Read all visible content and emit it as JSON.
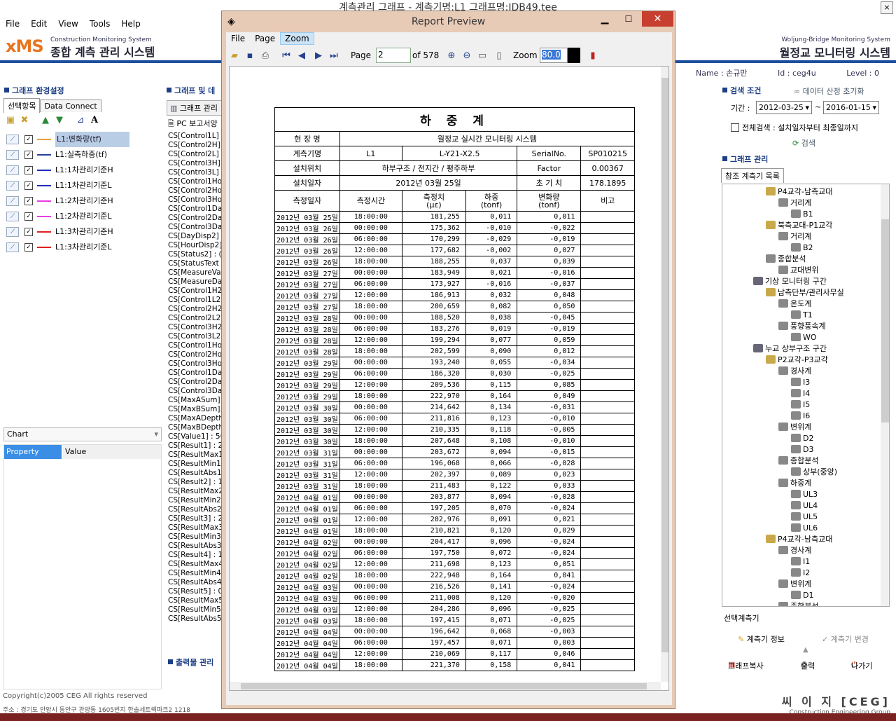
{
  "main_window": {
    "title": "계측관리 그래프 - 계측기명:L1 그래프명:IDB49.tee",
    "close_glyph": "×",
    "menu": [
      "File",
      "Edit",
      "View",
      "Tools",
      "Help"
    ]
  },
  "brand_left": {
    "logo": "xMS",
    "sub": "Construction   Monitoring System",
    "ko": "종합 계측 관리 시스템"
  },
  "brand_right": {
    "sub": "Woljung-Bridge  Monitoring System",
    "ko": "월정교 모니터링 시스템"
  },
  "left_panel": {
    "header": "그래프 환경설정",
    "tabs": [
      "선택항목",
      "Data Connect"
    ],
    "series": [
      {
        "label": "L1:변화량(tf)",
        "color": "#e8a040",
        "checked": true
      },
      {
        "label": "L1:실측하중(tf)",
        "color": "#2a3f9a",
        "checked": true
      },
      {
        "label": "L1:1차관리기준H",
        "color": "#1c2fb8",
        "checked": true
      },
      {
        "label": "L1:1차관리기준L",
        "color": "#1c2fb8",
        "checked": true
      },
      {
        "label": "L1:2차관리기준H",
        "color": "#e83ce8",
        "checked": true
      },
      {
        "label": "L1:2차관리기준L",
        "color": "#e83ce8",
        "checked": true
      },
      {
        "label": "L1:3차관리기준H",
        "color": "#e02020",
        "checked": true
      },
      {
        "label": "L1:3차관리기준L",
        "color": "#e02020",
        "checked": true
      }
    ],
    "chart_combo": "Chart",
    "property_header": "Property",
    "value_header": "Value"
  },
  "mid_panel": {
    "header": "그래프 및 데",
    "tab": "그래프 관리",
    "sub": "PC 보고서양",
    "out_header": "출력물 관리",
    "items": [
      "CS[Control1L]",
      "CS[Control2H]",
      "CS[Control2L]",
      "CS[Control3H]",
      "CS[Control3L]",
      "CS[Control1Ho",
      "CS[Control2Ho",
      "CS[Control3Ho",
      "CS[Control1Da",
      "CS[Control2Da",
      "CS[Control3Da",
      "CS[DayDisp2] :",
      "CS[HourDisp2]",
      "CS[Status2] : (",
      "CS[StatusText",
      "CS[MeasureVal",
      "CS[MeasureDa",
      "CS[Control1H2",
      "CS[Control1L2]",
      "CS[Control2H2",
      "CS[Control2L2]",
      "CS[Control3H2",
      "CS[Control3L2]",
      "CS[Control1Ho",
      "CS[Control2Ho",
      "CS[Control3Ho",
      "CS[Control1Da",
      "CS[Control2Da",
      "CS[Control3Da",
      "CS[MaxASum]",
      "CS[MaxBSum]",
      "CS[MaxADepth",
      "CS[MaxBDepth",
      "CS[Value1] : 56",
      "CS[Result1] : 2",
      "CS[ResultMax1",
      "CS[ResultMin1]",
      "CS[ResultAbs1",
      "CS[Result2] : 1",
      "CS[ResultMax2",
      "CS[ResultMin2]",
      "CS[ResultAbs2",
      "CS[Result3] : 2",
      "CS[ResultMax3",
      "CS[ResultMin3]",
      "CS[ResultAbs3",
      "CS[Result4] : 1",
      "CS[ResultMax4",
      "CS[ResultMin4]",
      "CS[ResultAbs4",
      "CS[Result5] : 0",
      "CS[ResultMax5",
      "CS[ResultMin5]",
      "CS[ResultAbs5"
    ]
  },
  "report_preview": {
    "title": "Report Preview",
    "menu": [
      "File",
      "Page",
      "Zoom"
    ],
    "page_label": "Page",
    "page_value": "2",
    "page_of": "of 578",
    "zoom_label": "Zoom",
    "zoom_value": "80.0",
    "report": {
      "title": "하 중 계",
      "site_label": "현 장 명",
      "site_value": "월정교 실시간 모니터링 시스템",
      "instrument_label": "계측기명",
      "instrument_value": "L1",
      "model_value": "L-Y21-X2.5",
      "serial_label": "SerialNo.",
      "serial_value": "SP010215",
      "location_label": "설치위치",
      "location_value": "하부구조  /  전지간  / 평주하부",
      "factor_label": "Factor",
      "factor_value": "0.00367",
      "install_label": "설치일자",
      "install_value": "2012년 03월 25일",
      "initial_label": "초 기 치",
      "initial_value": "178.1895",
      "columns": [
        {
          "line1": "측정일자",
          "line2": ""
        },
        {
          "line1": "측정시간",
          "line2": ""
        },
        {
          "line1": "측정치",
          "line2": "(με)"
        },
        {
          "line1": "하중",
          "line2": "(tonf)"
        },
        {
          "line1": "변화량",
          "line2": "(tonf)"
        },
        {
          "line1": "비고",
          "line2": ""
        }
      ],
      "rows": [
        [
          "2012년 03월 25일",
          "18:00:00",
          "181,255",
          "0,011",
          "0,011",
          ""
        ],
        [
          "2012년 03월 26일",
          "00:00:00",
          "175,362",
          "-0,010",
          "-0,022",
          ""
        ],
        [
          "2012년 03월 26일",
          "06:00:00",
          "170,299",
          "-0,029",
          "-0,019",
          ""
        ],
        [
          "2012년 03월 26일",
          "12:00:00",
          "177,682",
          "-0,002",
          "0,027",
          ""
        ],
        [
          "2012년 03월 26일",
          "18:00:00",
          "188,255",
          "0,037",
          "0,039",
          ""
        ],
        [
          "2012년 03월 27일",
          "00:00:00",
          "183,949",
          "0,021",
          "-0,016",
          ""
        ],
        [
          "2012년 03월 27일",
          "06:00:00",
          "173,927",
          "-0,016",
          "-0,037",
          ""
        ],
        [
          "2012년 03월 27일",
          "12:00:00",
          "186,913",
          "0,032",
          "0,048",
          ""
        ],
        [
          "2012년 03월 27일",
          "18:00:00",
          "200,659",
          "0,082",
          "0,050",
          ""
        ],
        [
          "2012년 03월 28일",
          "00:00:00",
          "188,520",
          "0,038",
          "-0,045",
          ""
        ],
        [
          "2012년 03월 28일",
          "06:00:00",
          "183,276",
          "0,019",
          "-0,019",
          ""
        ],
        [
          "2012년 03월 28일",
          "12:00:00",
          "199,294",
          "0,077",
          "0,059",
          ""
        ],
        [
          "2012년 03월 28일",
          "18:00:00",
          "202,599",
          "0,090",
          "0,012",
          ""
        ],
        [
          "2012년 03월 29일",
          "00:00:00",
          "193,240",
          "0,055",
          "-0,034",
          ""
        ],
        [
          "2012년 03월 29일",
          "06:00:00",
          "186,320",
          "0,030",
          "-0,025",
          ""
        ],
        [
          "2012년 03월 29일",
          "12:00:00",
          "209,536",
          "0,115",
          "0,085",
          ""
        ],
        [
          "2012년 03월 29일",
          "18:00:00",
          "222,970",
          "0,164",
          "0,049",
          ""
        ],
        [
          "2012년 03월 30일",
          "00:00:00",
          "214,642",
          "0,134",
          "-0,031",
          ""
        ],
        [
          "2012년 03월 30일",
          "06:00:00",
          "211,816",
          "0,123",
          "-0,010",
          ""
        ],
        [
          "2012년 03월 30일",
          "12:00:00",
          "210,335",
          "0,118",
          "-0,005",
          ""
        ],
        [
          "2012년 03월 30일",
          "18:00:00",
          "207,648",
          "0,108",
          "-0,010",
          ""
        ],
        [
          "2012년 03월 31일",
          "00:00:00",
          "203,672",
          "0,094",
          "-0,015",
          ""
        ],
        [
          "2012년 03월 31일",
          "06:00:00",
          "196,068",
          "0,066",
          "-0,028",
          ""
        ],
        [
          "2012년 03월 31일",
          "12:00:00",
          "202,397",
          "0,089",
          "0,023",
          ""
        ],
        [
          "2012년 03월 31일",
          "18:00:00",
          "211,483",
          "0,122",
          "0,033",
          ""
        ],
        [
          "2012년 04월 01일",
          "00:00:00",
          "203,877",
          "0,094",
          "-0,028",
          ""
        ],
        [
          "2012년 04월 01일",
          "06:00:00",
          "197,205",
          "0,070",
          "-0,024",
          ""
        ],
        [
          "2012년 04월 01일",
          "12:00:00",
          "202,976",
          "0,091",
          "0,021",
          ""
        ],
        [
          "2012년 04월 01일",
          "18:00:00",
          "210,821",
          "0,120",
          "0,029",
          ""
        ],
        [
          "2012년 04월 02일",
          "00:00:00",
          "204,417",
          "0,096",
          "-0,024",
          ""
        ],
        [
          "2012년 04월 02일",
          "06:00:00",
          "197,750",
          "0,072",
          "-0,024",
          ""
        ],
        [
          "2012년 04월 02일",
          "12:00:00",
          "211,698",
          "0,123",
          "0,051",
          ""
        ],
        [
          "2012년 04월 02일",
          "18:00:00",
          "222,948",
          "0,164",
          "0,041",
          ""
        ],
        [
          "2012년 04월 03일",
          "00:00:00",
          "216,526",
          "0,141",
          "-0,024",
          ""
        ],
        [
          "2012년 04월 03일",
          "06:00:00",
          "211,008",
          "0,120",
          "-0,020",
          ""
        ],
        [
          "2012년 04월 03일",
          "12:00:00",
          "204,286",
          "0,096",
          "-0,025",
          ""
        ],
        [
          "2012년 04월 03일",
          "18:00:00",
          "197,415",
          "0,071",
          "-0,025",
          ""
        ],
        [
          "2012년 04월 04일",
          "00:00:00",
          "196,642",
          "0,068",
          "-0,003",
          ""
        ],
        [
          "2012년 04월 04일",
          "06:00:00",
          "197,457",
          "0,071",
          "0,003",
          ""
        ],
        [
          "2012년 04월 04일",
          "12:00:00",
          "210,069",
          "0,117",
          "0,046",
          ""
        ],
        [
          "2012년 04월 04일",
          "18:00:00",
          "221,370",
          "0,158",
          "0,041",
          ""
        ]
      ]
    }
  },
  "right_panel": {
    "user": {
      "name_label": "Name :",
      "name": "손규만",
      "id_label": "Id :",
      "id": "ceg4u",
      "level_label": "Level :",
      "level": "0"
    },
    "search_header": "검색 조건",
    "reset_link": "데이터 산정 초기화",
    "period_label": "기간 :",
    "date_from": "2012-03-25",
    "date_to": "2016-01-15",
    "tilde": "~",
    "all_search": "전체검색 : 설치일자부터 최종일까지",
    "search_button": "검색",
    "graph_header": "그래프 관리",
    "tree_tab": "참조 계측기 목록",
    "tree": [
      {
        "label": "P4교각-남측교대",
        "level": 1,
        "kind": "folder"
      },
      {
        "label": "거리계",
        "level": 2,
        "kind": "device"
      },
      {
        "label": "B1",
        "level": 3,
        "kind": "sensor"
      },
      {
        "label": "북측교대-P1교각",
        "level": 1,
        "kind": "folder"
      },
      {
        "label": "거리계",
        "level": 2,
        "kind": "device"
      },
      {
        "label": "B2",
        "level": 3,
        "kind": "sensor"
      },
      {
        "label": "종합분석",
        "level": 1,
        "kind": "device"
      },
      {
        "label": "교대변위",
        "level": 2,
        "kind": "sensor"
      },
      {
        "label": "기상 모니터링 구간",
        "level": 0,
        "kind": "pc"
      },
      {
        "label": "남측단부/관리사무실",
        "level": 1,
        "kind": "folder"
      },
      {
        "label": "온도계",
        "level": 2,
        "kind": "device"
      },
      {
        "label": "T1",
        "level": 3,
        "kind": "sensor"
      },
      {
        "label": "풍향풍속계",
        "level": 2,
        "kind": "device"
      },
      {
        "label": "WO",
        "level": 3,
        "kind": "sensor"
      },
      {
        "label": "누교 상부구조 구간",
        "level": 0,
        "kind": "pc"
      },
      {
        "label": "P2교각-P3교각",
        "level": 1,
        "kind": "folder"
      },
      {
        "label": "경사계",
        "level": 2,
        "kind": "device"
      },
      {
        "label": "I3",
        "level": 3,
        "kind": "sensor"
      },
      {
        "label": "I4",
        "level": 3,
        "kind": "sensor"
      },
      {
        "label": "I5",
        "level": 3,
        "kind": "sensor"
      },
      {
        "label": "I6",
        "level": 3,
        "kind": "sensor"
      },
      {
        "label": "변위계",
        "level": 2,
        "kind": "device"
      },
      {
        "label": "D2",
        "level": 3,
        "kind": "sensor"
      },
      {
        "label": "D3",
        "level": 3,
        "kind": "sensor"
      },
      {
        "label": "종합분석",
        "level": 2,
        "kind": "device"
      },
      {
        "label": "상부(중앙)",
        "level": 3,
        "kind": "sensor"
      },
      {
        "label": "하중계",
        "level": 2,
        "kind": "device"
      },
      {
        "label": "UL3",
        "level": 3,
        "kind": "sensor"
      },
      {
        "label": "UL4",
        "level": 3,
        "kind": "sensor"
      },
      {
        "label": "UL5",
        "level": 3,
        "kind": "sensor"
      },
      {
        "label": "UL6",
        "level": 3,
        "kind": "sensor"
      },
      {
        "label": "P4교각-남측교대",
        "level": 1,
        "kind": "folder"
      },
      {
        "label": "경사계",
        "level": 2,
        "kind": "device"
      },
      {
        "label": "I1",
        "level": 3,
        "kind": "sensor"
      },
      {
        "label": "I2",
        "level": 3,
        "kind": "sensor"
      },
      {
        "label": "변위계",
        "level": 2,
        "kind": "device"
      },
      {
        "label": "D1",
        "level": 3,
        "kind": "sensor"
      },
      {
        "label": "종합분석",
        "level": 2,
        "kind": "device"
      }
    ],
    "selected_label": "선택계측기",
    "info_button": "계측기 정보",
    "change_button": "계측기 변경",
    "copy_button": "그래프복사",
    "print_button": "출력",
    "exit_button": "나가기"
  },
  "footer": {
    "copyright": "Copyright(c)2005 CEG All rights reserved",
    "address": "주소 : 경기도 안양시 동안구 관양동 1605번지 한솔세트렉파크2  1218",
    "company": "씨 이 지 [CEG]",
    "company_sub": "Construction  Engineering Group"
  }
}
